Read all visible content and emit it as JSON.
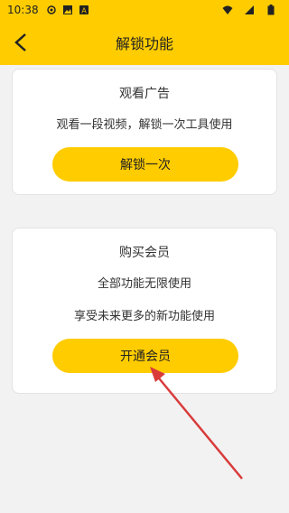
{
  "status_bar": {
    "time": "10:38",
    "icons_left": [
      "android-settings-icon",
      "image-icon",
      "font-a-icon"
    ],
    "icons_right": [
      "wifi-icon",
      "signal-icon",
      "battery-icon"
    ]
  },
  "header": {
    "title": "解锁功能",
    "back_icon": "chevron-left-icon"
  },
  "ad_card": {
    "title": "观看广告",
    "description": "观看一段视频，解锁一次工具使用",
    "button_label": "解锁一次"
  },
  "vip_card": {
    "title": "购买会员",
    "line1": "全部功能无限使用",
    "line2": "享受未来更多的新功能使用",
    "button_label": "开通会员"
  },
  "colors": {
    "accent": "#ffcc00",
    "annotation_arrow": "#d93b3b",
    "background": "#f2f2f2"
  }
}
